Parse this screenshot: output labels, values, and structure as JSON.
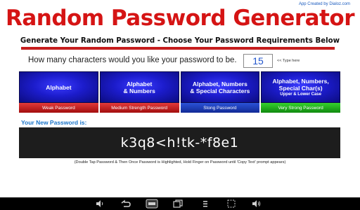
{
  "credit": "App Created by Dialoz.com",
  "title": "Random Password Generator",
  "subtitle": "Generate Your Random Password - Choose Your Password Requirements Below",
  "question": "How many characters would you like your password to be.",
  "length_value": "15",
  "type_hint": "<< Type here",
  "options": [
    {
      "line1": "Alphabet",
      "line2": "",
      "line3": "",
      "strength": "Weak Password"
    },
    {
      "line1": "Alphabet",
      "line2": "& Numbers",
      "line3": "",
      "strength": "Medium Strength Password"
    },
    {
      "line1": "Alphabet, Numbers",
      "line2": "& Special Characters",
      "line3": "",
      "strength": "Stong Password"
    },
    {
      "line1": "Alphabet, Numbers,",
      "line2": "Special Char(s)",
      "line3": "Upper & Lower Case",
      "strength": "Very Strong Password"
    }
  ],
  "new_password_label": "Your New Password is:",
  "password": "k3q8<h!tk-*f8e1",
  "instructions": "(Double Tap Password & Then Once Password is Highlighted, Hold Finger on Password until 'Copy Text' prompt appears)",
  "navbar": {
    "icons": [
      "volume-down-icon",
      "back-icon",
      "home-icon",
      "recent-apps-icon",
      "menu-icon",
      "screenshot-icon",
      "volume-up-icon"
    ]
  },
  "colors": {
    "title": "#d51414",
    "label_blue": "#1a74c9",
    "weak": "#c01818",
    "medium": "#c01818",
    "strong": "#1a3ab8",
    "very_strong": "#1ea51a"
  }
}
